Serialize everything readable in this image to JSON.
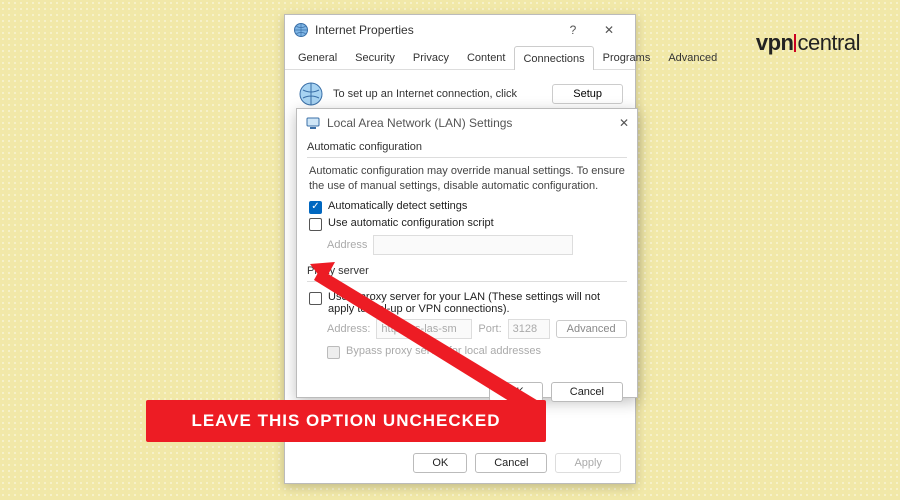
{
  "brand": {
    "prefix": "vpn",
    "suffix": "central"
  },
  "parent": {
    "title": "Internet Properties",
    "help": "?",
    "close": "✕",
    "tabs": [
      "General",
      "Security",
      "Privacy",
      "Content",
      "Connections",
      "Programs",
      "Advanced"
    ],
    "active_tab_index": 4,
    "setup_text": "To set up an Internet connection, click",
    "setup_button": "Setup",
    "footer": {
      "ok": "OK",
      "cancel": "Cancel",
      "apply": "Apply"
    }
  },
  "lan": {
    "title": "Local Area Network (LAN) Settings",
    "close": "✕",
    "auto": {
      "title": "Automatic configuration",
      "desc": "Automatic configuration may override manual settings. To ensure the use of manual settings, disable automatic configuration.",
      "detect_label": "Automatically detect settings",
      "detect_checked": true,
      "script_label": "Use automatic configuration script",
      "script_checked": false,
      "address_label": "Address"
    },
    "proxy": {
      "title": "Proxy server",
      "use_label": "Use a proxy server for your LAN (These settings will not apply to dial-up or VPN connections).",
      "use_checked": false,
      "addr_label": "Address:",
      "addr_value": "http://us-las-sm",
      "port_label": "Port:",
      "port_value": "3128",
      "advanced": "Advanced",
      "bypass_label": "Bypass proxy server for local addresses"
    },
    "buttons": {
      "ok": "OK",
      "cancel": "Cancel"
    }
  },
  "annotation": {
    "text": "LEAVE THIS OPTION UNCHECKED"
  }
}
